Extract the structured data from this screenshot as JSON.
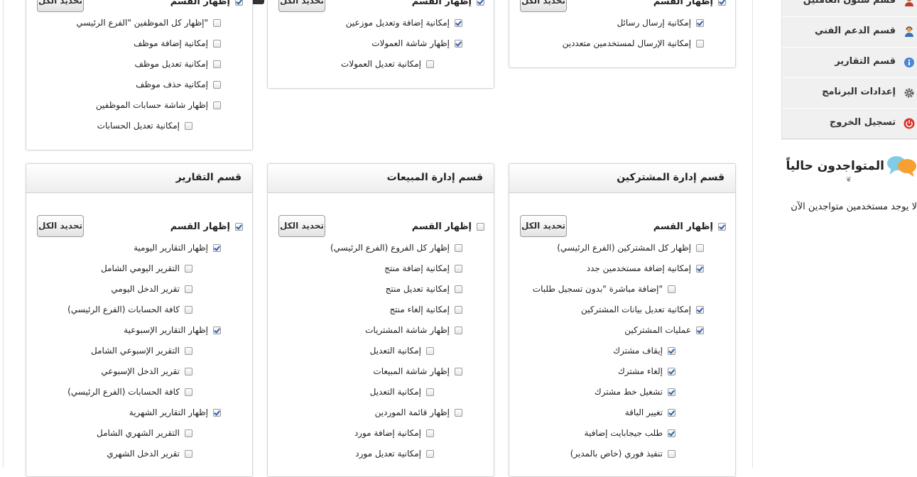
{
  "sidebar": {
    "items": [
      {
        "label": "قسم شئون العاملين",
        "icon": "users-icon"
      },
      {
        "label": "قسم الدعم الفني",
        "icon": "support-user-icon"
      },
      {
        "label": "قسم التقارير",
        "icon": "info-icon"
      },
      {
        "label": "إعدادات البرنامج",
        "icon": "gear-icon"
      },
      {
        "label": "تسجيل الخروج",
        "icon": "power-icon"
      }
    ],
    "online": {
      "title": "المتواجدون حالياً",
      "empty_text": "لا يوجد مستخدمين متواجدين الآن"
    }
  },
  "select_all_label": "تحديد الكل",
  "show_section_label": "إظهار القسم",
  "boxes_top": [
    {
      "show_checked": true,
      "items": [
        {
          "label": "إمكانية إرسال رسائل",
          "checked": true,
          "indent": 0
        },
        {
          "label": "إمكانية الإرسال لمستخدمين متعددين",
          "checked": false,
          "indent": 0
        }
      ]
    },
    {
      "show_checked": true,
      "items": [
        {
          "label": "إمكانية إضافة وتعديل موزعين",
          "checked": true,
          "indent": 0
        },
        {
          "label": "إظهار شاشة العمولات",
          "checked": true,
          "indent": 0
        },
        {
          "label": "إمكانية تعديل العمولات",
          "checked": false,
          "indent": 1
        }
      ]
    },
    {
      "show_checked": true,
      "items": [
        {
          "label": "إظهار كل الموظفين \"الفرع الرئيسي\"",
          "checked": false,
          "indent": 0
        },
        {
          "label": "إمكانية إضافة موظف",
          "checked": false,
          "indent": 0
        },
        {
          "label": "إمكانية تعديل موظف",
          "checked": false,
          "indent": 0
        },
        {
          "label": "إمكانية حذف موظف",
          "checked": false,
          "indent": 0
        },
        {
          "label": "إظهار شاشة حسابات الموظفين",
          "checked": false,
          "indent": 0
        },
        {
          "label": "إمكانية تعديل الحسابات",
          "checked": false,
          "indent": 1
        }
      ]
    }
  ],
  "boxes_bottom": [
    {
      "title": "قسم إدارة المشتركين",
      "show_checked": true,
      "items": [
        {
          "label": "إظهار كل المشتركين (الفرع الرئيسي)",
          "checked": false,
          "indent": 0
        },
        {
          "label": "إمكانية إضافة مستخدمين جدد",
          "checked": true,
          "indent": 0
        },
        {
          "label": "إضافة مباشرة \"بدون تسجيل طلبات\"",
          "checked": false,
          "indent": 1
        },
        {
          "label": "إمكانية تعديل بيانات المشتركين",
          "checked": true,
          "indent": 0
        },
        {
          "label": "عمليات المشتركين",
          "checked": true,
          "indent": 0
        },
        {
          "label": "إيقاف مشترك",
          "checked": true,
          "indent": 1
        },
        {
          "label": "إلغاء مشترك",
          "checked": true,
          "indent": 1
        },
        {
          "label": "تشغيل خط مشترك",
          "checked": true,
          "indent": 1
        },
        {
          "label": "تغيير الباقة",
          "checked": true,
          "indent": 1
        },
        {
          "label": "طلب جيجابايت إضافية",
          "checked": true,
          "indent": 1
        },
        {
          "label": "تنفيذ فوري (خاص بالمدير)",
          "checked": false,
          "indent": 1
        }
      ]
    },
    {
      "title": "قسم إدارة المبيعات",
      "show_checked": false,
      "items": [
        {
          "label": "إظهار كل الفروع (الفرع الرئيسي)",
          "checked": false,
          "indent": 0
        },
        {
          "label": "إمكانية إضافة منتج",
          "checked": false,
          "indent": 0
        },
        {
          "label": "إمكانية تعديل منتج",
          "checked": false,
          "indent": 0
        },
        {
          "label": "إمكانية إلغاء منتج",
          "checked": false,
          "indent": 0
        },
        {
          "label": "إظهار شاشة المشتريات",
          "checked": false,
          "indent": 0
        },
        {
          "label": "إمكانية التعديل",
          "checked": false,
          "indent": 1
        },
        {
          "label": "إظهار شاشة المبيعات",
          "checked": false,
          "indent": 0
        },
        {
          "label": "إمكانية التعديل",
          "checked": false,
          "indent": 1
        },
        {
          "label": "إظهار قائمة الموردين",
          "checked": false,
          "indent": 0
        },
        {
          "label": "إمكانية إضافة مورد",
          "checked": false,
          "indent": 1
        },
        {
          "label": "إمكانية تعديل مورد",
          "checked": false,
          "indent": 1
        }
      ]
    },
    {
      "title": "قسم التقارير",
      "show_checked": true,
      "items": [
        {
          "label": "إظهار التقارير اليومية",
          "checked": true,
          "indent": 0
        },
        {
          "label": "التقرير اليومي الشامل",
          "checked": false,
          "indent": 1
        },
        {
          "label": "تقرير الدخل اليومي",
          "checked": false,
          "indent": 1
        },
        {
          "label": "كافة الحسابات (الفرع الرئيسي)",
          "checked": false,
          "indent": 1
        },
        {
          "label": "إظهار التقارير الإسبوعية",
          "checked": true,
          "indent": 0
        },
        {
          "label": "التقرير الإسبوعي الشامل",
          "checked": false,
          "indent": 1
        },
        {
          "label": "تقرير الدخل الإسبوعي",
          "checked": false,
          "indent": 1
        },
        {
          "label": "كافة الحسابات (الفرع الرئيسي)",
          "checked": false,
          "indent": 1
        },
        {
          "label": "إظهار التقارير الشهرية",
          "checked": true,
          "indent": 0
        },
        {
          "label": "التقرير الشهري الشامل",
          "checked": false,
          "indent": 1
        },
        {
          "label": "تقرير الدخل الشهري",
          "checked": false,
          "indent": 1
        }
      ]
    }
  ]
}
